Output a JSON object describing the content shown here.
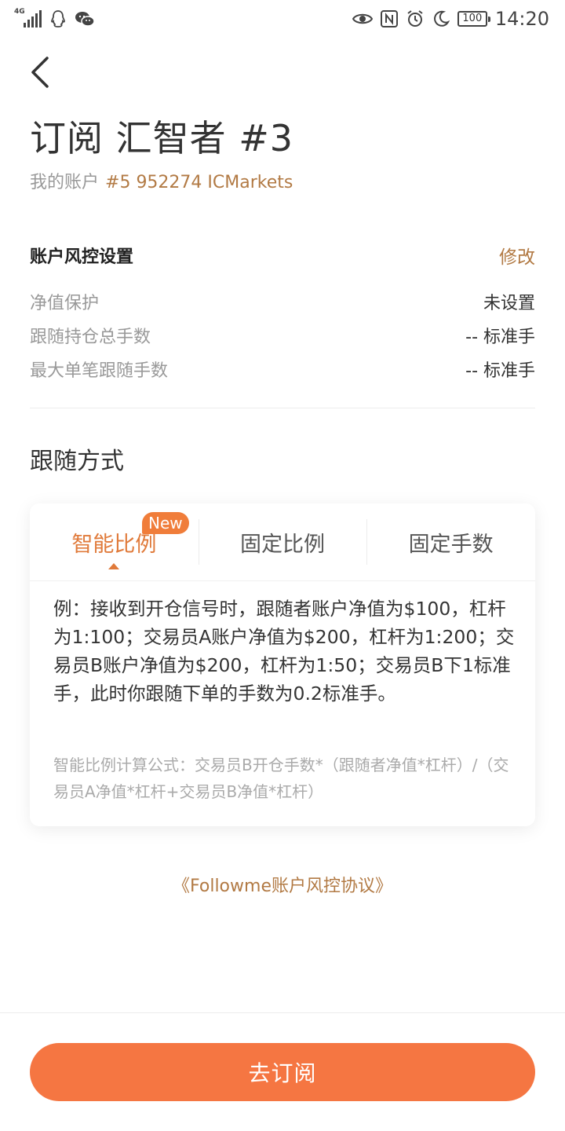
{
  "status_bar": {
    "network": "4G",
    "time": "14:20",
    "battery": "100",
    "icons": [
      "signal-icon",
      "qq-icon",
      "wechat-icon",
      "eye-icon",
      "nfc-icon",
      "alarm-icon",
      "moon-icon",
      "battery-icon"
    ]
  },
  "header": {
    "title": "订阅 汇智者 #3",
    "account_label": "我的账户",
    "account_value": "#5 952274 ICMarkets"
  },
  "risk": {
    "title": "账户风控设置",
    "edit_label": "修改",
    "rows": [
      {
        "label": "净值保护",
        "value": "未设置"
      },
      {
        "label": "跟随持仓总手数",
        "value": "-- 标准手"
      },
      {
        "label": "最大单笔跟随手数",
        "value": "-- 标准手"
      }
    ]
  },
  "follow": {
    "title": "跟随方式",
    "tabs": [
      {
        "label": "智能比例",
        "active": true
      },
      {
        "label": "固定比例",
        "active": false
      },
      {
        "label": "固定手数",
        "active": false
      }
    ],
    "new_badge": "New",
    "example": "例：接收到开仓信号时，跟随者账户净值为$100，杠杆为1:100；交易员A账户净值为$200，杠杆为1:200；交易员B账户净值为$200，杠杆为1:50；交易员B下1标准手，此时你跟随下单的手数为0.2标准手。",
    "formula": "智能比例计算公式：交易员B开仓手数*（跟随者净值*杠杆）/（交易员A净值*杠杆+交易员B净值*杠杆）"
  },
  "protocol_link": "《Followme账户风控协议》",
  "subscribe_button": "去订阅",
  "colors": {
    "accent": "#f57642",
    "link": "#b27a44",
    "active_tab": "#e07a3a"
  }
}
